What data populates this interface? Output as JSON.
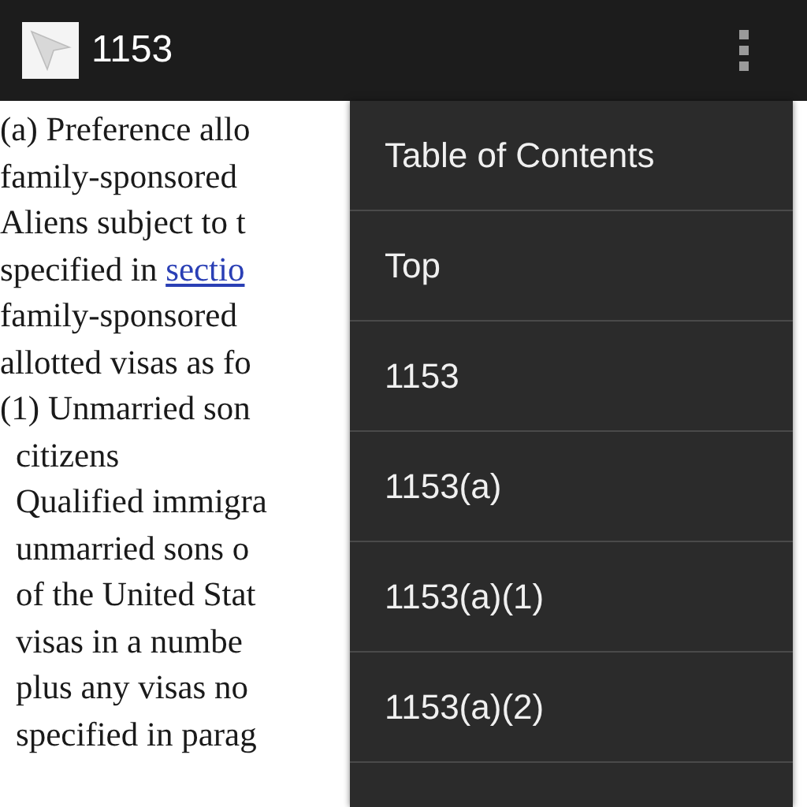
{
  "action_bar": {
    "title": "1153"
  },
  "body": {
    "lines": [
      {
        "text": "(a) Preference allo",
        "indented": false
      },
      {
        "text": "family-sponsored",
        "indented": false
      },
      {
        "text": "Aliens subject to t",
        "indented": false
      },
      {
        "text": "specified in ",
        "link": "sectio",
        "indented": false
      },
      {
        "text": "family-sponsored",
        "indented": false
      },
      {
        "text": "allotted visas as fo",
        "indented": false
      },
      {
        "text": "(1) Unmarried son",
        "indented": false
      },
      {
        "text": "citizens",
        "indented": true
      },
      {
        "text": "Qualified immigra",
        "indented": true
      },
      {
        "text": "unmarried sons o",
        "indented": true
      },
      {
        "text": "of the United Stat",
        "indented": true
      },
      {
        "text": "visas in a numbe",
        "indented": true
      },
      {
        "text": "plus any visas no",
        "indented": true
      },
      {
        "text": "specified in parag",
        "indented": true
      }
    ]
  },
  "menu": {
    "items": [
      "Table of Contents",
      "Top",
      "1153",
      "1153(a)",
      "1153(a)(1)",
      "1153(a)(2)"
    ]
  }
}
